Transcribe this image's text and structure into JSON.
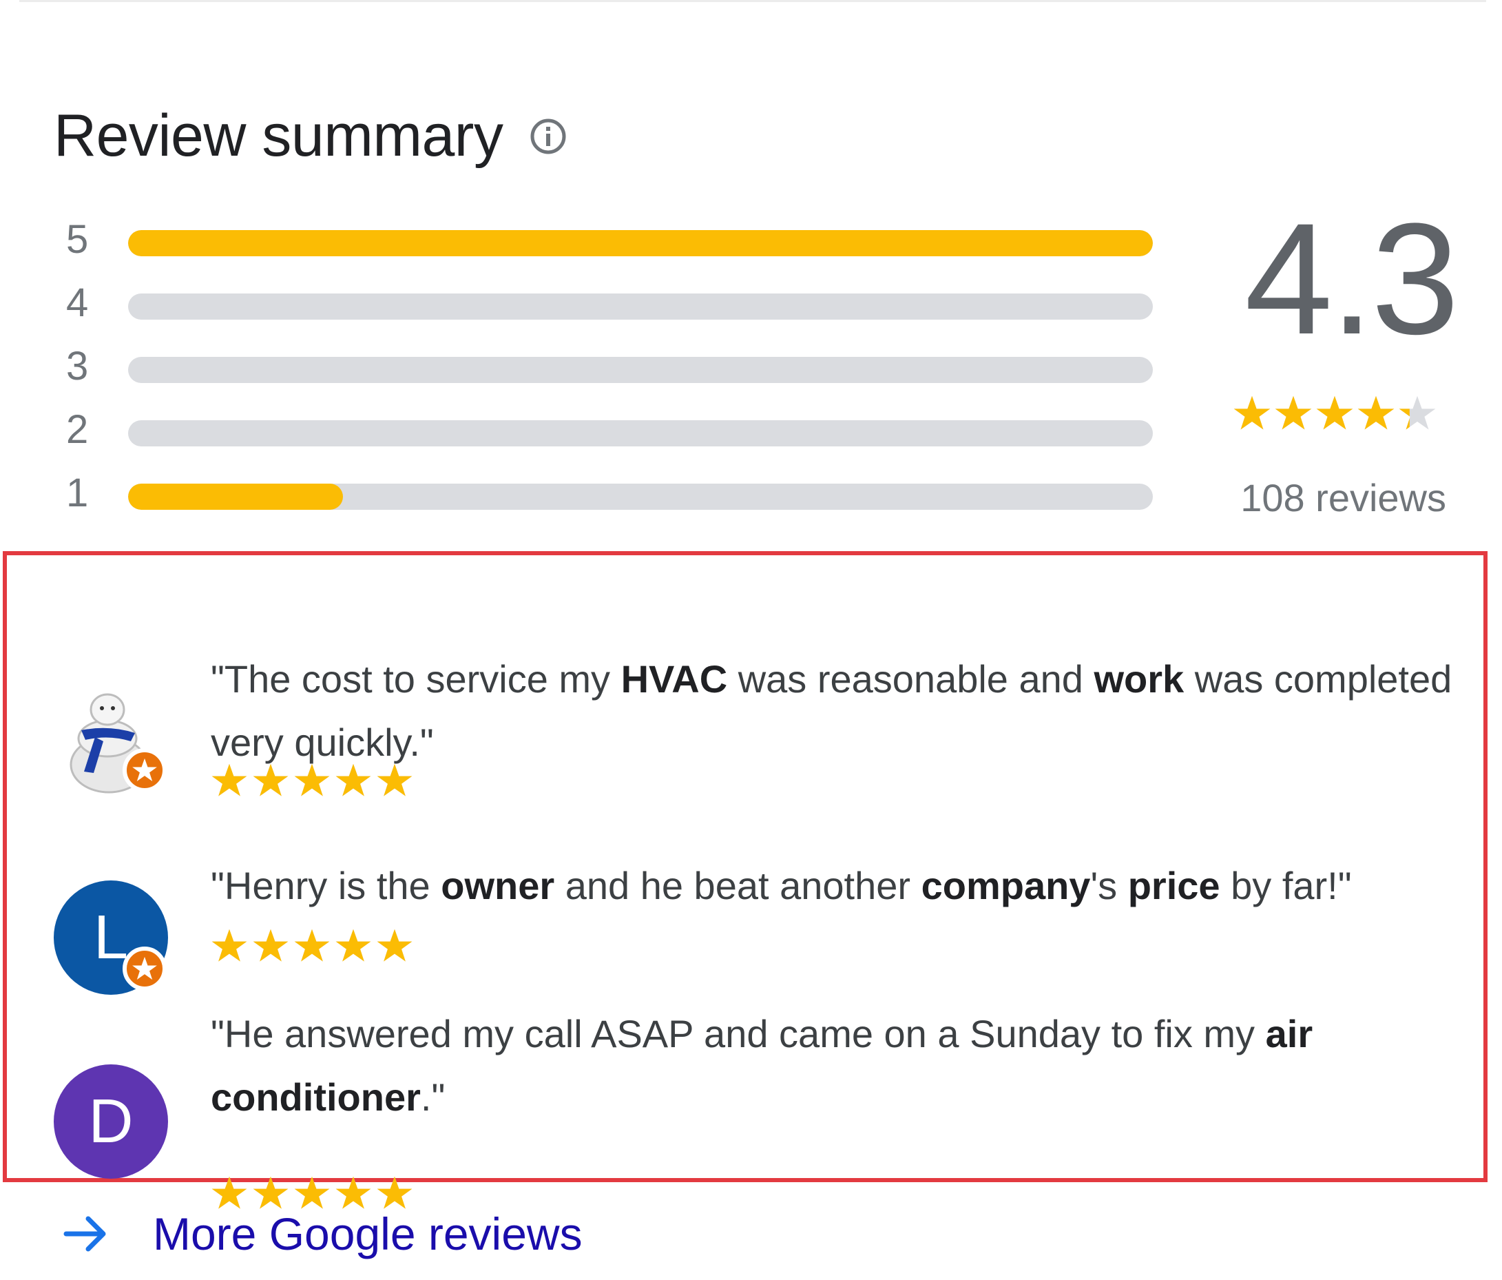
{
  "summary": {
    "title": "Review summary",
    "info_icon": "info-icon",
    "average": "4.3",
    "average_rating": 4.3,
    "count_label": "108 reviews"
  },
  "distribution": [
    {
      "label": "5",
      "fraction": 1.0
    },
    {
      "label": "4",
      "fraction": 0.0
    },
    {
      "label": "3",
      "fraction": 0.0
    },
    {
      "label": "2",
      "fraction": 0.0
    },
    {
      "label": "1",
      "fraction": 0.21
    }
  ],
  "reviews": [
    {
      "avatar": "mascot-avatar",
      "avatar_letter": "",
      "avatar_color": "#ffffff",
      "badge": "local-guide-badge-icon",
      "quote_parts": [
        "\"The cost to service my ",
        "HVAC",
        " was reasonable and ",
        "work",
        " was completed very quickly.\""
      ],
      "bold_indexes": [
        1,
        3
      ],
      "rating": 5
    },
    {
      "avatar": "letter-avatar",
      "avatar_letter": "L",
      "avatar_color": "#0b57a4",
      "badge": "local-guide-badge-icon",
      "quote_parts": [
        "\"Henry is the ",
        "owner",
        " and he beat another ",
        "company",
        "'s ",
        "price",
        " by far!\""
      ],
      "bold_indexes": [
        1,
        3,
        5
      ],
      "rating": 5
    },
    {
      "avatar": "letter-avatar",
      "avatar_letter": "D",
      "avatar_color": "#5e35b1",
      "badge": "",
      "quote_parts": [
        "\"He answered my call ASAP and came on a Sunday to fix my ",
        "air conditioner",
        ".\""
      ],
      "bold_indexes": [
        1
      ],
      "rating": 5
    }
  ],
  "more_link": {
    "label": "More Google reviews",
    "icon": "arrow-right-icon"
  },
  "colors": {
    "star": "#fbbc04",
    "track": "#dadce0",
    "link": "#1a0dab",
    "highlight": "#e33a40",
    "arrow": "#1a73e8"
  }
}
